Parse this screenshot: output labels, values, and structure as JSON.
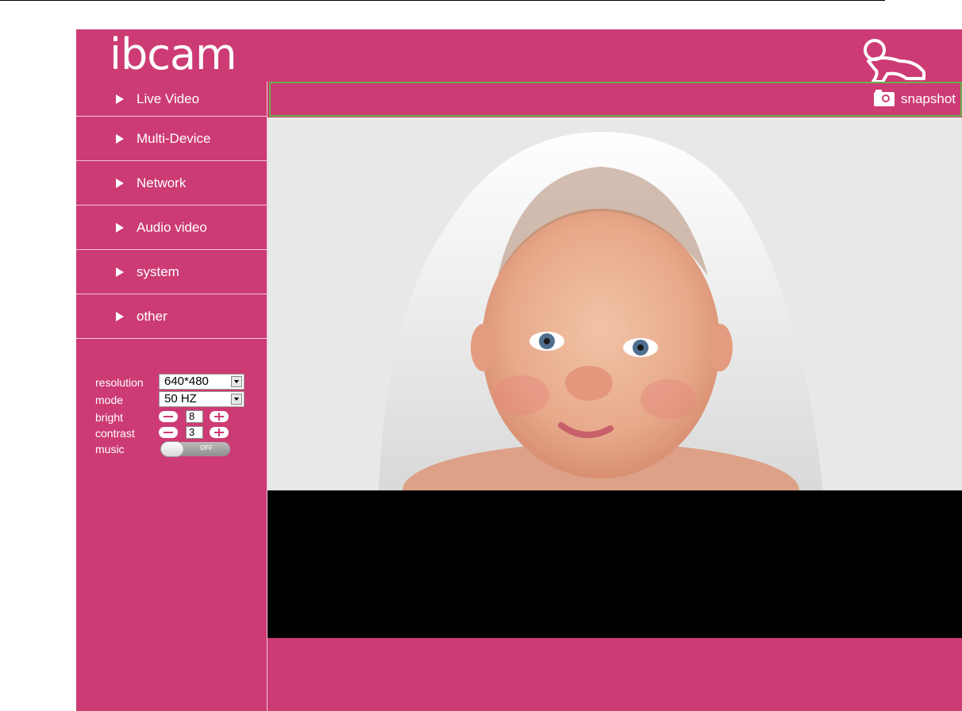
{
  "app": {
    "logo_text": "ibcam",
    "brand_color": "#cd3b74",
    "accent_border": "#6ab04c"
  },
  "nav": {
    "items": [
      {
        "label": "Live Video"
      },
      {
        "label": "Multi-Device"
      },
      {
        "label": "Network"
      },
      {
        "label": "Audio video"
      },
      {
        "label": "system"
      },
      {
        "label": "other"
      }
    ]
  },
  "controls": {
    "resolution": {
      "label": "resolution",
      "value": "640*480"
    },
    "mode": {
      "label": "mode",
      "value": "50 HZ"
    },
    "bright": {
      "label": "bright",
      "value": "8"
    },
    "contrast": {
      "label": "contrast",
      "value": "3"
    },
    "music": {
      "label": "music",
      "state_label": "OFF"
    }
  },
  "toolbar": {
    "snapshot_label": "snapshot"
  },
  "icons": {
    "logo": "baby-crawling-icon",
    "snapshot": "camera-icon",
    "nav_arrow": "triangle-right-icon"
  }
}
